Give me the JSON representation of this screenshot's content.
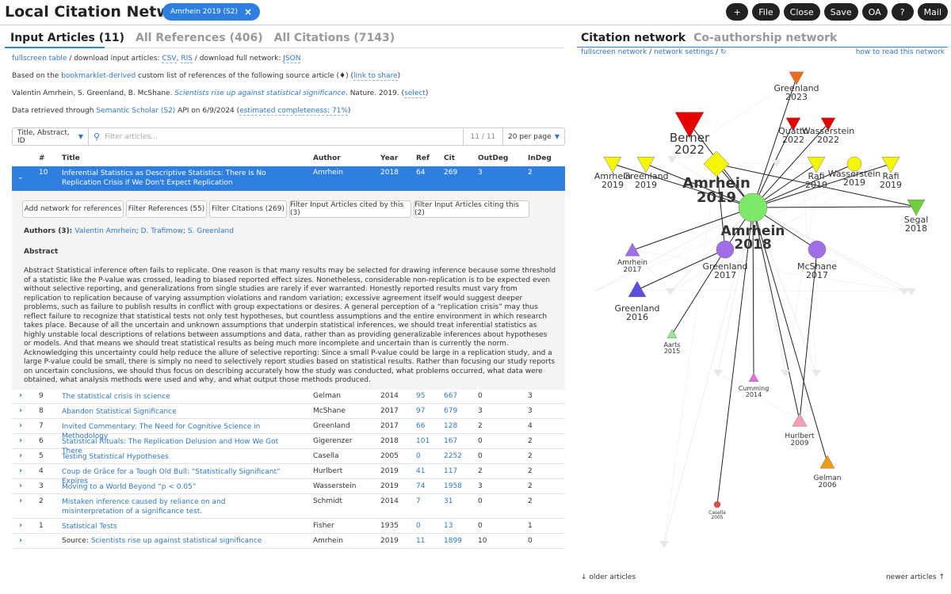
{
  "header": {
    "title": "Local Citation Network",
    "source_tag": "Amrhein 2019 (S2)",
    "toolbar": [
      {
        "name": "add-button",
        "label": "+"
      },
      {
        "name": "file-button",
        "label": "File"
      },
      {
        "name": "close-button",
        "label": "Close"
      },
      {
        "name": "save-button",
        "label": "Save"
      },
      {
        "name": "oa-button",
        "label": "OA"
      },
      {
        "name": "help-button",
        "label": "?"
      },
      {
        "name": "mail-button",
        "label": "Mail"
      }
    ]
  },
  "left_tabs": [
    "Input Articles (11)",
    "All References (406)",
    "All Citations (7143)"
  ],
  "right_tabs": [
    "Citation network",
    "Co-authorship network"
  ],
  "info": {
    "line1_a": "fullscreen table",
    "line1_b": " / download input articles: ",
    "line1_c": "CSV",
    "line1_d": ", ",
    "line1_e": "RIS",
    "line1_f": " / download full network: ",
    "line1_g": "JSON",
    "line2_a": "Based on the ",
    "line2_b": "bookmarklet-derived",
    "line2_c": " custom list of references of the following source article (♦) (",
    "line2_d": "link to share",
    "line2_e": ")",
    "line3_a": "Valentin Amrhein, S. Greenland, B. McShane. ",
    "line3_b": "Scientists rise up against statistical significance",
    "line3_c": ". Nature. 2019. (",
    "line3_d": "select",
    "line3_e": ")",
    "line4_a": "Data retrieved through ",
    "line4_b": "Semantic Scholar (S2)",
    "line4_c": " API on 6/9/2024 (",
    "line4_d": "estimated completeness: 71%",
    "line4_e": ")"
  },
  "search": {
    "field": "Title, Abstract, ID",
    "placeholder": "Filter articles...",
    "count": "11 / 11",
    "per_page": "20 per page"
  },
  "table": {
    "headers": {
      "num": "#",
      "title": "Title",
      "author": "Author",
      "year": "Year",
      "ref": "Ref",
      "cit": "Cit",
      "outdeg": "OutDeg",
      "indeg": "InDeg"
    },
    "selected": {
      "num": "10",
      "title": "Inferential Statistics as Descriptive Statistics: There Is No Replication Crisis if We Don't Expect Replication",
      "author": "Amrhein",
      "year": "2018",
      "ref": "64",
      "cit": "269",
      "outdeg": "3",
      "indeg": "2"
    },
    "expanded": {
      "buttons": [
        "Add network for references",
        "Filter References (55)",
        "Filter Citations (269)",
        "Filter Input Articles cited by this (3)",
        "Filter Input Articles citing this (2)"
      ],
      "authors_label": "Authors (3): ",
      "authors": [
        "Valentin Amrhein",
        "D. Trafimow",
        "S. Greenland"
      ],
      "abstract_heading": "Abstract",
      "abstract": "Abstract Statistical inference often fails to replicate. One reason is that many results may be selected for drawing inference because some threshold of a statistic like the P-value was crossed, leading to biased reported effect sizes. Nonetheless, considerable non-replication is to be expected even without selective reporting, and generalizations from single studies are rarely if ever warranted. Honestly reported results must vary from replication to replication because of varying assumption violations and random variation; excessive agreement itself would suggest deeper problems, such as failure to publish results in conflict with group expectations or desires. A general perception of a “replication crisis” may thus reflect failure to recognize that statistical tests not only test hypotheses, but countless assumptions and the entire environment in which research takes place. Because of all the uncertain and unknown assumptions that underpin statistical inferences, we should treat inferential statistics as highly unstable local descriptions of relations between assumptions and data, rather than as providing generalizable inferences about hypotheses or models. And that means we should treat statistical results as being much more incomplete and uncertain than is currently the norm. Acknowledging this uncertainty could help reduce the allure of selective reporting: Since a small P-value could be large in a replication study, and a large P-value could be small, there is simply no need to selectively report studies based on statistical results. Rather than focusing our study reports on uncertain conclusions, we should thus focus on describing accurately how the study was conducted, what problems occurred, what data were obtained, what analysis methods were used and why, and what output those methods produced."
    },
    "rows": [
      {
        "num": "9",
        "title": "The statistical crisis in science",
        "author": "Gelman",
        "year": "2014",
        "ref": "95",
        "cit": "667",
        "outdeg": "0",
        "indeg": "3"
      },
      {
        "num": "8",
        "title": "Abandon Statistical Significance",
        "author": "McShane",
        "year": "2017",
        "ref": "97",
        "cit": "679",
        "outdeg": "3",
        "indeg": "3"
      },
      {
        "num": "7",
        "title": "Invited Commentary: The Need for Cognitive Science in Methodology",
        "author": "Greenland",
        "year": "2017",
        "ref": "66",
        "cit": "128",
        "outdeg": "2",
        "indeg": "4"
      },
      {
        "num": "6",
        "title": "Statistical Rituals: The Replication Delusion and How We Got There",
        "author": "Gigerenzer",
        "year": "2018",
        "ref": "101",
        "cit": "167",
        "outdeg": "0",
        "indeg": "2"
      },
      {
        "num": "5",
        "title": "Testing Statistical Hypotheses",
        "author": "Casella",
        "year": "2005",
        "ref": "0",
        "cit": "2252",
        "outdeg": "0",
        "indeg": "2"
      },
      {
        "num": "4",
        "title": "Coup de Grâce for a Tough Old Bull: “Statistically Significant” Expires",
        "author": "Hurlbert",
        "year": "2019",
        "ref": "41",
        "cit": "117",
        "outdeg": "2",
        "indeg": "2"
      },
      {
        "num": "3",
        "title": "Moving to a World Beyond “p < 0.05”",
        "author": "Wasserstein",
        "year": "2019",
        "ref": "74",
        "cit": "1958",
        "outdeg": "3",
        "indeg": "2"
      },
      {
        "num": "2",
        "title": "Mistaken inference caused by reliance on and misinterpretation of a significance test.",
        "author": "Schmidt",
        "year": "2014",
        "ref": "7",
        "cit": "31",
        "outdeg": "0",
        "indeg": "2"
      },
      {
        "num": "1",
        "title": "Statistical Tests",
        "author": "Fisher",
        "year": "1935",
        "ref": "0",
        "cit": "13",
        "outdeg": "0",
        "indeg": "1"
      }
    ],
    "source_row": {
      "prefix": "Source: ",
      "title": "Scientists rise up against statistical significance",
      "author": "Amrhein",
      "year": "2019",
      "ref": "11",
      "cit": "1899",
      "outdeg": "10",
      "indeg": "0"
    }
  },
  "network": {
    "links_left": [
      "fullscreen network",
      " / ",
      "network settings",
      " / ",
      "↻"
    ],
    "link_right": "how to read this network",
    "bottom_left": "↓ older articles",
    "bottom_right": "newer articles ↑",
    "nodes": [
      {
        "label": "Greenland 2023",
        "name": "Greenland",
        "year": "2023",
        "shape": "tri-down",
        "color": "#f26a1b",
        "size": "s",
        "emph": false
      },
      {
        "label": "Berner 2022",
        "name": "Berner",
        "year": "2022",
        "shape": "tri-down",
        "color": "#e60000",
        "size": "xl",
        "emph": false
      },
      {
        "label": "Quatto 2022",
        "name": "Quatto",
        "year": "2022",
        "shape": "tri-down",
        "color": "#e60000",
        "size": "s",
        "emph": false
      },
      {
        "label": "Wasserstein 2022",
        "name": "Wasserstein",
        "year": "2022",
        "shape": "tri-down",
        "color": "#e60000",
        "size": "s",
        "emph": false
      },
      {
        "label": "Amrhein 2019",
        "name": "Amrhein",
        "year": "2019",
        "shape": "tri-down",
        "color": "#f5f50a",
        "size": "m",
        "emph": false
      },
      {
        "label": "Greenland 2019",
        "name": "Greenland",
        "year": "2019",
        "shape": "tri-down",
        "color": "#f5f50a",
        "size": "m",
        "emph": false
      },
      {
        "label": "Amrhein 2019 (source)",
        "name": "Amrhein",
        "year": "2019",
        "shape": "diamond",
        "color": "#f5f50a",
        "size": "l",
        "emph": true
      },
      {
        "label": "Rafi 2019",
        "name": "Rafi",
        "year": "2019",
        "shape": "tri-down",
        "color": "#f5f50a",
        "size": "m",
        "emph": false
      },
      {
        "label": "Wasserstein 2019",
        "name": "Wasserstein",
        "year": "2019",
        "shape": "circle",
        "color": "#f5f50a",
        "size": "s",
        "emph": false
      },
      {
        "label": "Rafi 2019",
        "name": "Rafi",
        "year": "2019",
        "shape": "tri-down",
        "color": "#f5f50a",
        "size": "m",
        "emph": false
      },
      {
        "label": "Segal 2018",
        "name": "Segal",
        "year": "2018",
        "shape": "tri-down",
        "color": "#6ecf3a",
        "size": "m",
        "emph": false
      },
      {
        "label": "Amrhein 2018",
        "name": "Amrhein",
        "year": "2018",
        "shape": "circle",
        "color": "#7ee86a",
        "size": "xl",
        "emph": true
      },
      {
        "label": "Amrhein 2017",
        "name": "Amrhein",
        "year": "2017",
        "shape": "tri-up",
        "color": "#a06ee6",
        "size": "s",
        "emph": false
      },
      {
        "label": "Greenland 2017",
        "name": "Greenland",
        "year": "2017",
        "shape": "circle",
        "color": "#a06ee6",
        "size": "m",
        "emph": false
      },
      {
        "label": "McShane 2017",
        "name": "McShane",
        "year": "2017",
        "shape": "circle",
        "color": "#a06ee6",
        "size": "m",
        "emph": false
      },
      {
        "label": "Greenland 2016",
        "name": "Greenland",
        "year": "2016",
        "shape": "tri-up",
        "color": "#5a50e0",
        "size": "m",
        "emph": false
      },
      {
        "label": "Aarts 2015",
        "name": "Aarts",
        "year": "2015",
        "shape": "tri-up",
        "color": "#9be89b",
        "size": "xs",
        "emph": false
      },
      {
        "label": "Cumming 2014",
        "name": "Cumming",
        "year": "2014",
        "shape": "tri-up",
        "color": "#e86ee0",
        "size": "xs",
        "emph": false
      },
      {
        "label": "Hurlbert 2009",
        "name": "Hurlbert",
        "year": "2009",
        "shape": "tri-up",
        "color": "#f4a0b0",
        "size": "s",
        "emph": false
      },
      {
        "label": "Gelman 2006",
        "name": "Gelman",
        "year": "2006",
        "shape": "tri-up",
        "color": "#f29a10",
        "size": "s",
        "emph": false
      },
      {
        "label": "Casella 2005",
        "name": "Casella",
        "year": "2005",
        "shape": "circle",
        "color": "#e84a4a",
        "size": "xxs",
        "emph": false
      }
    ]
  }
}
